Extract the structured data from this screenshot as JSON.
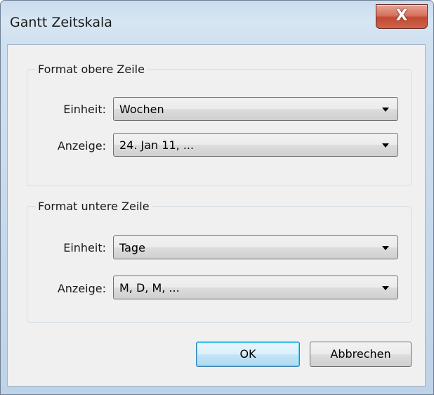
{
  "window": {
    "title": "Gantt Zeitskala",
    "close_glyph": "X"
  },
  "upper_group": {
    "legend": "Format obere Zeile",
    "unit_label": "Einheit:",
    "unit_value": "Wochen",
    "display_label": "Anzeige:",
    "display_value": "24. Jan 11, ..."
  },
  "lower_group": {
    "legend": "Format untere Zeile",
    "unit_label": "Einheit:",
    "unit_value": "Tage",
    "display_label": "Anzeige:",
    "display_value": "M, D, M, ..."
  },
  "buttons": {
    "ok": "OK",
    "cancel": "Abbrechen"
  },
  "icons": {
    "close": "close-icon",
    "dropdown": "chevron-down-icon"
  },
  "colors": {
    "close_button": "#c14a33",
    "default_button_border": "#3c7fb1"
  }
}
